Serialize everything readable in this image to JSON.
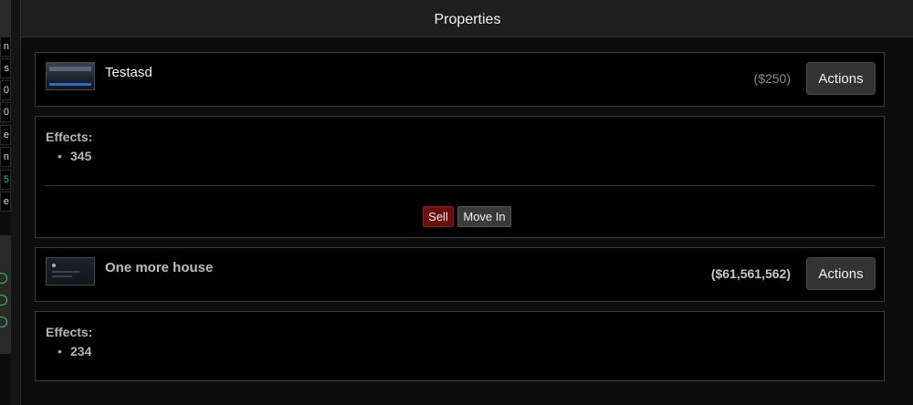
{
  "window": {
    "title": "Properties"
  },
  "sidebar": {
    "fragments": [
      "n",
      "s",
      "0",
      "0",
      "e",
      "n",
      "5",
      "e"
    ]
  },
  "properties": [
    {
      "name": "Testasd",
      "price": "($250)",
      "actions_label": "Actions",
      "effects_title": "Effects:",
      "effects": [
        "345"
      ],
      "sell_label": "Sell",
      "move_in_label": "Move In"
    },
    {
      "name": "One more house",
      "price": "($61,561,562)",
      "actions_label": "Actions",
      "effects_title": "Effects:",
      "effects": [
        "234"
      ]
    }
  ],
  "colors": {
    "background": "#0c0c0c",
    "panel": "#000000",
    "sell_button": "#6a0e0e",
    "accent_green": "#2ecc40"
  }
}
